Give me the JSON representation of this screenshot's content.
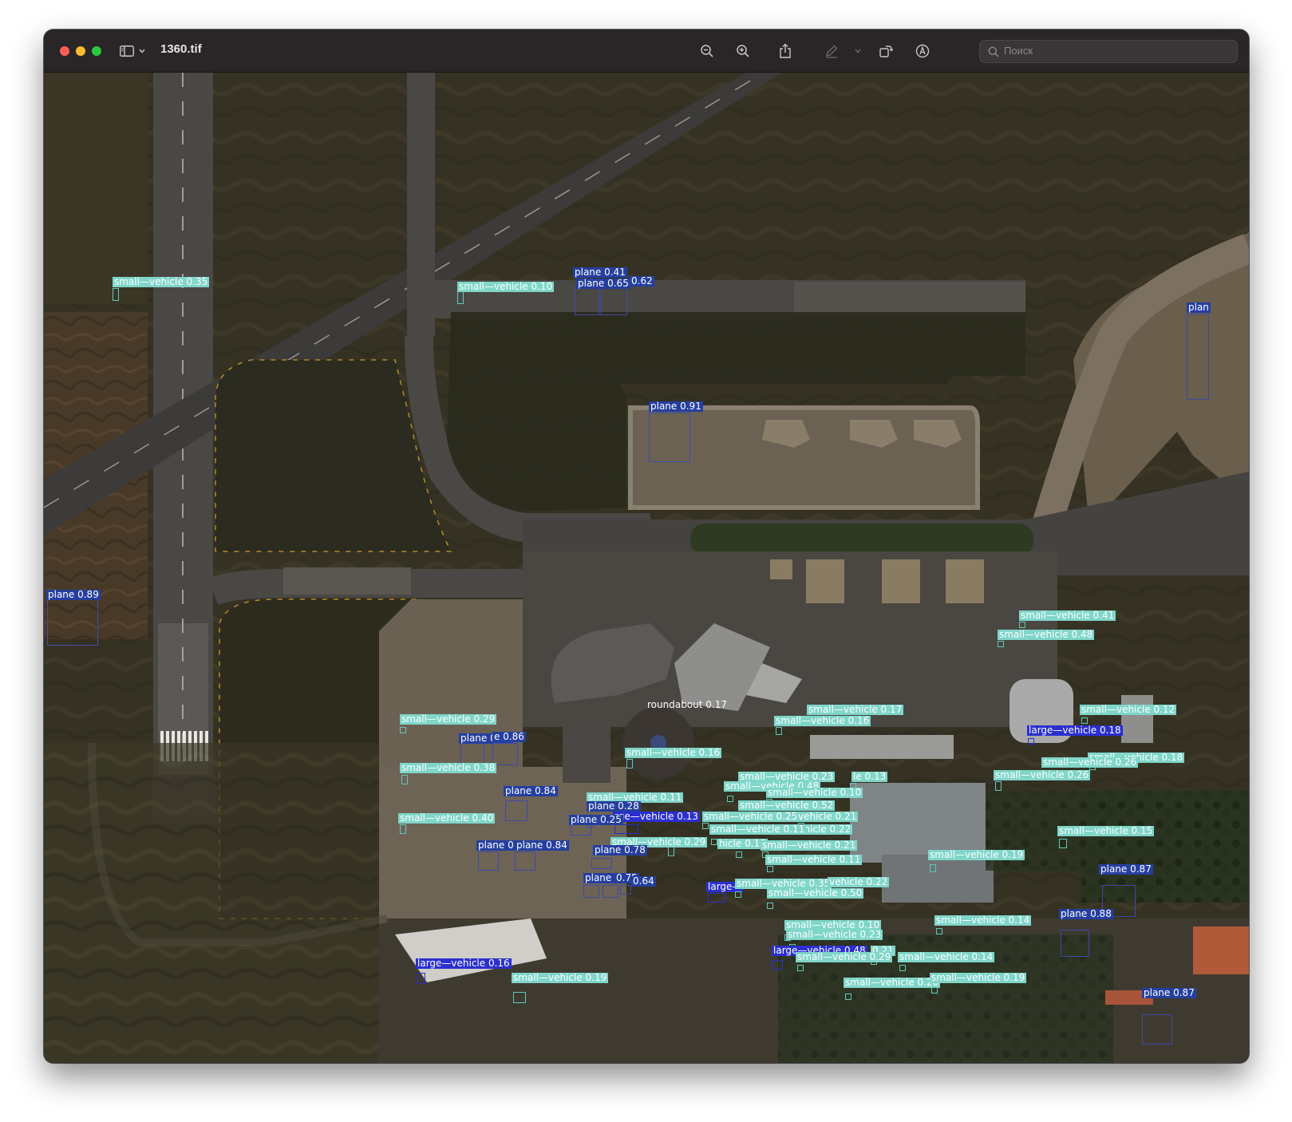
{
  "window": {
    "title": "1360.tif",
    "search_placeholder": "Поиск"
  },
  "toolbar": {
    "icons": [
      "sidebar-icon",
      "chevron-down-icon",
      "zoom-out-icon",
      "zoom-in-icon",
      "share-icon",
      "markup-pen-icon",
      "chevron-down-icon",
      "rotate-icon",
      "annotate-icon",
      "search-icon"
    ]
  },
  "colors": {
    "plane_box": "#253fa0",
    "vehicle_box": "#7fd6c9",
    "large_vehicle_box": "#2b2fd0"
  },
  "detections": [
    {
      "cls": "small-vehicle",
      "label": "small—vehicle 0.35"
    },
    {
      "cls": "small-vehicle",
      "label": "small—vehicle 0.10"
    },
    {
      "cls": "plane",
      "label": "plane 0.41"
    },
    {
      "cls": "plane",
      "label": "plane 0.65"
    },
    {
      "cls": "plane",
      "label": "0.62"
    },
    {
      "cls": "plane",
      "label": "plan"
    },
    {
      "cls": "plane",
      "label": "plane 0.91"
    },
    {
      "cls": "plane",
      "label": "plane 0.89"
    },
    {
      "cls": "small-vehicle",
      "label": "small—vehicle 0.41"
    },
    {
      "cls": "small-vehicle",
      "label": "small—vehicle 0.48"
    },
    {
      "cls": "small-vehicle",
      "label": "small—vehicle 0.17"
    },
    {
      "cls": "small-vehicle",
      "label": "small—vehicle 0.16"
    },
    {
      "cls": "small-vehicle",
      "label": "small—vehicle 0.12"
    },
    {
      "cls": "large-vehicle",
      "label": "large—vehicle 0.18"
    },
    {
      "cls": "roundabout",
      "label": "roundabout 0.17"
    },
    {
      "cls": "small-vehicle",
      "label": "small—vehicle 0.29"
    },
    {
      "cls": "plane",
      "label": "plane 0.87"
    },
    {
      "cls": "plane",
      "label": "e 0.86"
    },
    {
      "cls": "small-vehicle",
      "label": "small—vehicle 0.16"
    },
    {
      "cls": "small-vehicle",
      "label": "small—vehicle 0.38"
    },
    {
      "cls": "small-vehicle",
      "label": "small—vehicle 0.18"
    },
    {
      "cls": "small-vehicle",
      "label": "small—vehicle 0.26"
    },
    {
      "cls": "small-vehicle",
      "label": "small—vehicle 0.26"
    },
    {
      "cls": "small-vehicle",
      "label": "small—vehicle 0.23"
    },
    {
      "cls": "small-vehicle",
      "label": "le 0.13"
    },
    {
      "cls": "small-vehicle",
      "label": "small—vehicle 0.48"
    },
    {
      "cls": "small-vehicle",
      "label": "small—vehicle 0.10"
    },
    {
      "cls": "plane",
      "label": "plane 0.84"
    },
    {
      "cls": "small-vehicle",
      "label": "small—vehicle 0.11"
    },
    {
      "cls": "small-vehicle",
      "label": "small—vehicle 0.52"
    },
    {
      "cls": "plane",
      "label": "plane 0.28"
    },
    {
      "cls": "small-vehicle",
      "label": "small—vehicle 0.40"
    },
    {
      "cls": "large-vehicle",
      "label": "rge—vehicle 0.13"
    },
    {
      "cls": "plane",
      "label": "plane 0.25"
    },
    {
      "cls": "small-vehicle",
      "label": "small—vehicle 0.25"
    },
    {
      "cls": "small-vehicle",
      "label": "vehicle 0.21"
    },
    {
      "cls": "small-vehicle",
      "label": "small—vehicle 0.22"
    },
    {
      "cls": "small-vehicle",
      "label": "small—vehicle 0.11"
    },
    {
      "cls": "small-vehicle",
      "label": "small—vehicle 0.15"
    },
    {
      "cls": "small-vehicle",
      "label": "small—vehicle 0.29"
    },
    {
      "cls": "small-vehicle",
      "label": "hicle 0.10"
    },
    {
      "cls": "small-vehicle",
      "label": "small—vehicle 0.21"
    },
    {
      "cls": "plane",
      "label": "plane 0"
    },
    {
      "cls": "plane",
      "label": "plane 0.84"
    },
    {
      "cls": "plane",
      "label": "plane 0.78"
    },
    {
      "cls": "small-vehicle",
      "label": "small—vehicle 0.11"
    },
    {
      "cls": "small-vehicle",
      "label": "small—vehicle 0.19"
    },
    {
      "cls": "plane",
      "label": "plane 0.75"
    },
    {
      "cls": "plane",
      "label": "0.75"
    },
    {
      "cls": "plane",
      "label": "0.64"
    },
    {
      "cls": "large-vehicle",
      "label": "large—"
    },
    {
      "cls": "small-vehicle",
      "label": "small—vehicle 0.35"
    },
    {
      "cls": "small-vehicle",
      "label": "vehicle 0.22"
    },
    {
      "cls": "small-vehicle",
      "label": "small—vehicle 0.50"
    },
    {
      "cls": "plane",
      "label": "plane 0.87"
    },
    {
      "cls": "plane",
      "label": "plane 0.88"
    },
    {
      "cls": "small-vehicle",
      "label": "small—vehicle 0.14"
    },
    {
      "cls": "small-vehicle",
      "label": "small—vehicle 0.10"
    },
    {
      "cls": "small-vehicle",
      "label": "small—vehicle 0.23"
    },
    {
      "cls": "large-vehicle",
      "label": "large—vehicle 0.48"
    },
    {
      "cls": "small-vehicle",
      "label": "0.21"
    },
    {
      "cls": "small-vehicle",
      "label": "small—vehicle 0.29"
    },
    {
      "cls": "small-vehicle",
      "label": "small—vehicle 0.14"
    },
    {
      "cls": "large-vehicle",
      "label": "large—vehicle 0.16"
    },
    {
      "cls": "small-vehicle",
      "label": "small—vehicle 0.19"
    },
    {
      "cls": "small-vehicle",
      "label": "small—vehicle 0.20"
    },
    {
      "cls": "small-vehicle",
      "label": "small—vehicle 0.19"
    },
    {
      "cls": "plane",
      "label": "plane 0.87"
    }
  ]
}
